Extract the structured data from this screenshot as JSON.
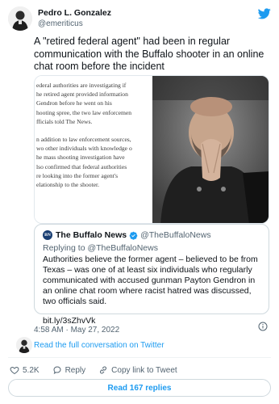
{
  "author": {
    "display_name": "Pedro L. Gonzalez",
    "handle": "@emeriticus"
  },
  "tweet": {
    "text": "A \"retired federal agent\" had been in regular communication with the Buffalo shooter in an online chat room before the incident",
    "timestamp": "4:58 AM · May 27, 2022"
  },
  "article_clip": {
    "lines": [
      "ederal authorities are investigating if",
      "he retired agent provided information",
      "Gendron before he went on his",
      "hooting spree, the two law enforcemen",
      "fficials told The News.",
      "n addition to law enforcement sources,",
      "wo other individuals with knowledge o",
      "he mass shooting investigation have",
      "lso confirmed that federal authorities",
      "re looking into the former agent's",
      "elationship to the shooter."
    ]
  },
  "quoted": {
    "logo_text": "BN",
    "name": "The Buffalo News",
    "handle": "@TheBuffaloNews",
    "replying_prefix": "Replying to",
    "replying_to": "@TheBuffaloNews",
    "text": "Authorities believe the former agent – believed to be from Texas – was one of at least six individuals who regularly communicated with accused gunman Payton Gendron in an online chat room where racist hatred was discussed, two officials said.",
    "link": "bit.ly/3sZhvVk"
  },
  "conversation": {
    "link_text": "Read the full conversation on Twitter"
  },
  "actions": {
    "likes": "5.2K",
    "reply": "Reply",
    "copy_link": "Copy link to Tweet"
  },
  "replies_button": "Read 167 replies",
  "colors": {
    "accent": "#1d9bf0",
    "text": "#0f1419",
    "muted": "#536471",
    "border": "#cfd9de"
  },
  "icons": [
    "twitter-bird-icon",
    "verified-badge-icon",
    "info-icon",
    "heart-icon",
    "reply-icon",
    "link-icon"
  ]
}
